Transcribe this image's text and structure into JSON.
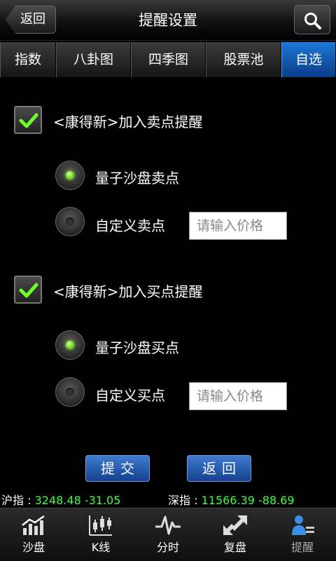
{
  "header": {
    "back_label": "返回",
    "title": "提醒设置"
  },
  "tabs": [
    {
      "label": "指数"
    },
    {
      "label": "八卦图"
    },
    {
      "label": "四季图"
    },
    {
      "label": "股票池"
    },
    {
      "label": "自选",
      "active": true
    }
  ],
  "sell_section": {
    "checkbox_label": "<康得新>加入卖点提醒",
    "checked": true,
    "option_quantum": "量子沙盘卖点",
    "option_custom": "自定义卖点",
    "price_placeholder": "请输入价格",
    "selected": "quantum"
  },
  "buy_section": {
    "checkbox_label": "<康得新>加入买点提醒",
    "checked": true,
    "option_quantum": "量子沙盘买点",
    "option_custom": "自定义买点",
    "price_placeholder": "请输入价格",
    "selected": "quantum"
  },
  "actions": {
    "submit_label": "提交",
    "back_label": "返回"
  },
  "ticker": {
    "sh_label": "沪指 : ",
    "sh_value": "3248.48 -31.05",
    "sz_label": "深指 : ",
    "sz_value": "11566.39 -88.69"
  },
  "bottom_nav": [
    {
      "label": "沙盘",
      "icon": "sandbox-chart-icon"
    },
    {
      "label": "K线",
      "icon": "candlestick-icon"
    },
    {
      "label": "分时",
      "icon": "timeshare-line-icon"
    },
    {
      "label": "复盘",
      "icon": "replay-arrows-icon"
    },
    {
      "label": "提醒",
      "icon": "alert-user-icon",
      "active": true
    }
  ],
  "colors": {
    "accent_blue": "#1e78d6",
    "ticker_green": "#3dff3d",
    "radio_on": "#5ecb14"
  }
}
